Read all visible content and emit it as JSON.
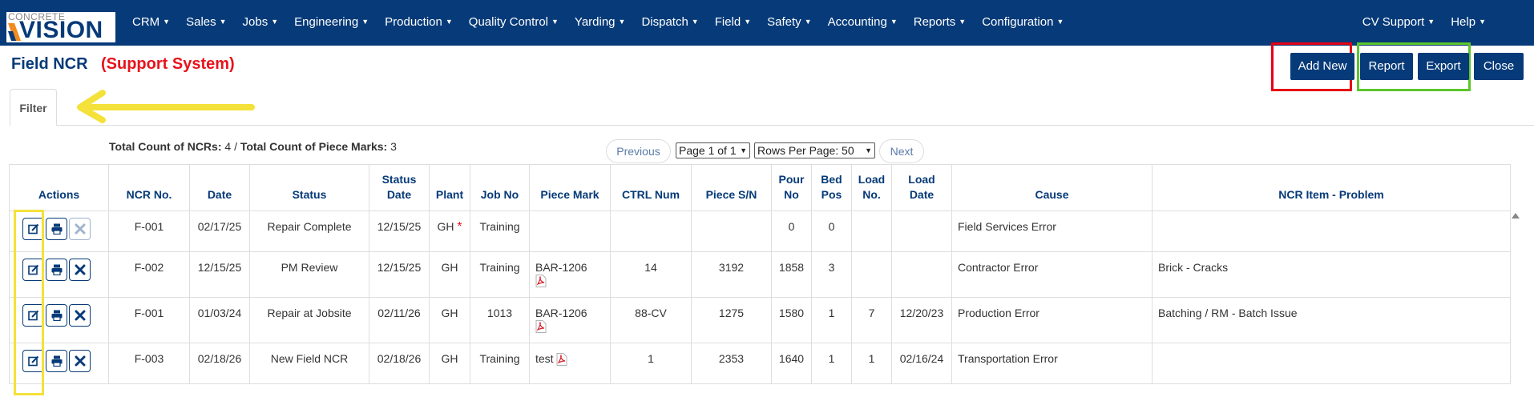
{
  "logo": {
    "small": "CONCRETE",
    "big": "VISION"
  },
  "nav": {
    "items": [
      "CRM",
      "Sales",
      "Jobs",
      "Engineering",
      "Production",
      "Quality Control",
      "Yarding",
      "Dispatch",
      "Field",
      "Safety",
      "Accounting",
      "Reports",
      "Configuration"
    ],
    "right": [
      "CV Support",
      "Help"
    ]
  },
  "header": {
    "title": "Field NCR",
    "support": "(Support System)"
  },
  "buttons": {
    "add_new": "Add New",
    "report": "Report",
    "export": "Export",
    "close": "Close"
  },
  "filter": {
    "tab_label": "Filter"
  },
  "counts": {
    "ncr_label": "Total Count of NCRs:",
    "ncr_value": "4",
    "separator": " / ",
    "pm_label": "Total Count of Piece Marks:",
    "pm_value": "3"
  },
  "pager": {
    "previous": "Previous",
    "next": "Next",
    "page": "Page 1 of 1",
    "rows": "Rows Per Page: 50"
  },
  "table": {
    "headers": {
      "actions": "Actions",
      "ncr_no": "NCR No.",
      "date": "Date",
      "status": "Status",
      "status_date_1": "Status",
      "status_date_2": "Date",
      "plant": "Plant",
      "job_no": "Job No",
      "piece_mark": "Piece Mark",
      "ctrl_num": "CTRL Num",
      "piece_sn": "Piece S/N",
      "pour_no_1": "Pour",
      "pour_no_2": "No",
      "bed_pos_1": "Bed",
      "bed_pos_2": "Pos",
      "load_no_1": "Load",
      "load_no_2": "No.",
      "load_date_1": "Load",
      "load_date_2": "Date",
      "cause": "Cause",
      "problem": "NCR Item - Problem"
    },
    "rows": [
      {
        "ncr_no": "F-001",
        "date": "02/17/25",
        "status": "Repair Complete",
        "status_date": "12/15/25",
        "plant": "GH",
        "plant_flag": "*",
        "job_no": "Training",
        "piece_mark": "",
        "ctrl_num": "",
        "piece_sn": "",
        "pour_no": "0",
        "bed_pos": "0",
        "load_no": "",
        "load_date": "",
        "cause": "Field Services Error",
        "problem": ""
      },
      {
        "ncr_no": "F-002",
        "date": "12/15/25",
        "status": "PM Review",
        "status_date": "12/15/25",
        "plant": "GH",
        "job_no": "Training",
        "piece_mark": "BAR-1206",
        "ctrl_num": "14",
        "piece_sn": "3192",
        "pour_no": "1858",
        "bed_pos": "3",
        "load_no": "",
        "load_date": "",
        "cause": "Contractor Error",
        "problem": "Brick - Cracks"
      },
      {
        "ncr_no": "F-001",
        "date": "01/03/24",
        "status": "Repair at Jobsite",
        "status_date": "02/11/26",
        "plant": "GH",
        "job_no": "1013",
        "piece_mark": "BAR-1206",
        "ctrl_num": "88-CV",
        "piece_sn": "1275",
        "pour_no": "1580",
        "bed_pos": "1",
        "load_no": "7",
        "load_date": "12/20/23",
        "cause": "Production Error",
        "problem": "Batching / RM - Batch Issue"
      },
      {
        "ncr_no": "F-003",
        "date": "02/18/26",
        "status": "New Field NCR",
        "status_date": "02/18/26",
        "plant": "GH",
        "job_no": "Training",
        "piece_mark": "test",
        "ctrl_num": "1",
        "piece_sn": "2353",
        "pour_no": "1640",
        "bed_pos": "1",
        "load_no": "1",
        "load_date": "02/16/24",
        "cause": "Transportation Error",
        "problem": ""
      }
    ]
  },
  "icons": {
    "edit": "edit-icon",
    "print": "print-icon",
    "delete": "delete-icon",
    "pdf": "pdf-icon"
  },
  "colors": {
    "navbar": "#063a78",
    "primary_button": "#063a78",
    "support_label": "#e8131c",
    "highlight_red": "#e60014",
    "highlight_green": "#5cc52b",
    "highlight_yellow": "#f4e13a"
  }
}
